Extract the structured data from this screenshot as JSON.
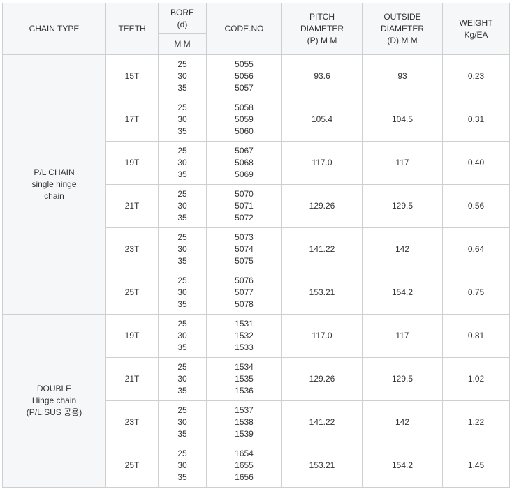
{
  "header": {
    "chain_type": "CHAIN TYPE",
    "teeth": "TEETH",
    "bore": [
      "BORE",
      "(d)"
    ],
    "bore_unit": "M M",
    "code_no": "CODE.NO",
    "pitch": [
      "PITCH",
      "DIAMETER",
      "(P) M M"
    ],
    "outside": [
      "OUTSIDE",
      "DIAMETER",
      "(D) M M"
    ],
    "weight": [
      "WEIGHT",
      "Kg/EA"
    ]
  },
  "groups": [
    {
      "label": [
        "P/L CHAIN",
        "single hinge",
        "chain"
      ],
      "rows": [
        {
          "teeth": "15T",
          "bores": [
            "25",
            "30",
            "35"
          ],
          "codes": [
            "5055",
            "5056",
            "5057"
          ],
          "pitch": "93.6",
          "outside": "93",
          "weight": "0.23"
        },
        {
          "teeth": "17T",
          "bores": [
            "25",
            "30",
            "35"
          ],
          "codes": [
            "5058",
            "5059",
            "5060"
          ],
          "pitch": "105.4",
          "outside": "104.5",
          "weight": "0.31"
        },
        {
          "teeth": "19T",
          "bores": [
            "25",
            "30",
            "35"
          ],
          "codes": [
            "5067",
            "5068",
            "5069"
          ],
          "pitch": "117.0",
          "outside": "117",
          "weight": "0.40"
        },
        {
          "teeth": "21T",
          "bores": [
            "25",
            "30",
            "35"
          ],
          "codes": [
            "5070",
            "5071",
            "5072"
          ],
          "pitch": "129.26",
          "outside": "129.5",
          "weight": "0.56"
        },
        {
          "teeth": "23T",
          "bores": [
            "25",
            "30",
            "35"
          ],
          "codes": [
            "5073",
            "5074",
            "5075"
          ],
          "pitch": "141.22",
          "outside": "142",
          "weight": "0.64"
        },
        {
          "teeth": "25T",
          "bores": [
            "25",
            "30",
            "35"
          ],
          "codes": [
            "5076",
            "5077",
            "5078"
          ],
          "pitch": "153.21",
          "outside": "154.2",
          "weight": "0.75"
        }
      ]
    },
    {
      "label": [
        "DOUBLE",
        "Hinge chain",
        "(P/L,SUS 공용)"
      ],
      "rows": [
        {
          "teeth": "19T",
          "bores": [
            "25",
            "30",
            "35"
          ],
          "codes": [
            "1531",
            "1532",
            "1533"
          ],
          "pitch": "117.0",
          "outside": "117",
          "weight": "0.81"
        },
        {
          "teeth": "21T",
          "bores": [
            "25",
            "30",
            "35"
          ],
          "codes": [
            "1534",
            "1535",
            "1536"
          ],
          "pitch": "129.26",
          "outside": "129.5",
          "weight": "1.02"
        },
        {
          "teeth": "23T",
          "bores": [
            "25",
            "30",
            "35"
          ],
          "codes": [
            "1537",
            "1538",
            "1539"
          ],
          "pitch": "141.22",
          "outside": "142",
          "weight": "1.22"
        },
        {
          "teeth": "25T",
          "bores": [
            "25",
            "30",
            "35"
          ],
          "codes": [
            "1654",
            "1655",
            "1656"
          ],
          "pitch": "153.21",
          "outside": "154.2",
          "weight": "1.45"
        }
      ]
    }
  ]
}
